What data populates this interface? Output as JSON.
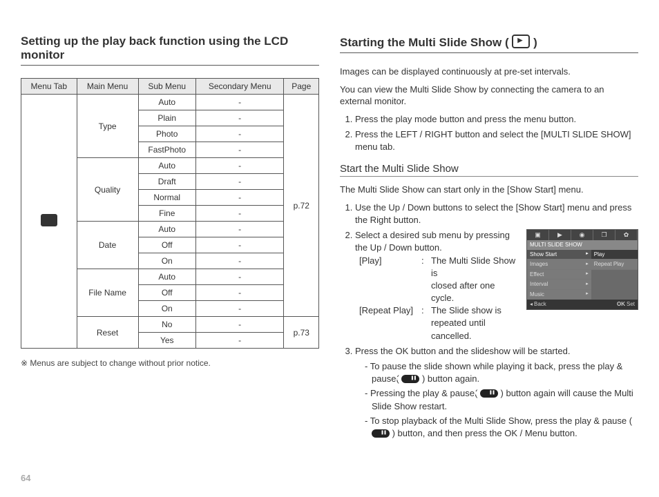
{
  "page_number": "64",
  "left": {
    "title": "Setting up the play back function using the LCD monitor",
    "table": {
      "headers": [
        "Menu Tab",
        "Main Menu",
        "Sub Menu",
        "Secondary Menu",
        "Page"
      ],
      "groups": [
        {
          "main": "Type",
          "subs": [
            "Auto",
            "Plain",
            "Photo",
            "FastPhoto"
          ],
          "page": "p.72"
        },
        {
          "main": "Quality",
          "subs": [
            "Auto",
            "Draft",
            "Normal",
            "Fine"
          ],
          "page": "p.72"
        },
        {
          "main": "Date",
          "subs": [
            "Auto",
            "Off",
            "On"
          ],
          "page": "p.72"
        },
        {
          "main": "File Name",
          "subs": [
            "Auto",
            "Off",
            "On"
          ],
          "page": "p.72"
        },
        {
          "main": "Reset",
          "subs": [
            "No",
            "Yes"
          ],
          "page": "p.73"
        }
      ],
      "secondary_dash": "-",
      "page_span1": "p.72",
      "page_span2": "p.73"
    },
    "footnote": "※  Menus are subject to change without prior notice."
  },
  "right": {
    "title_prefix": "Starting the Multi Slide Show ( ",
    "title_suffix": " )",
    "intro1": "Images can be displayed continuously at pre-set intervals.",
    "intro2": "You can view the Multi Slide Show by connecting the camera to an external monitor.",
    "steps_top": [
      "Press the play mode button and press the menu button.",
      "Press the LEFT / RIGHT button and select the [MULTI SLIDE SHOW] menu tab."
    ],
    "sub_title": "Start the Multi Slide Show",
    "sub_intro": "The Multi Slide Show can start only in the [Show Start] menu.",
    "sub_steps": {
      "s1": "Use the Up / Down buttons to select the [Show Start] menu and press the Right button.",
      "s2": "Select a desired sub menu by pressing the Up / Down button.",
      "defs": [
        {
          "label": "[Play]",
          "desc1": "The Multi Slide Show is",
          "desc2": "closed after one cycle."
        },
        {
          "label": "[Repeat Play]",
          "desc1": "The Slide show is",
          "desc2": "repeated until cancelled."
        }
      ],
      "s3": "Press the OK button and the slideshow will be started.",
      "bullets": [
        {
          "pre": "- To pause the slide shown while playing it back, press the play & pause( ",
          "post": " ) button again."
        },
        {
          "pre": "- Pressing the play & pause( ",
          "post": " ) button again will cause the Multi Slide Show restart."
        },
        {
          "pre": "- To stop playback of the Multi Slide Show, press the play & pause ( ",
          "post": " ) button, and then press the OK / Menu button."
        }
      ]
    },
    "lcd": {
      "title": "MULTI SLIDE SHOW",
      "left_items": [
        "Show Start",
        "Images",
        "Effect",
        "Interval",
        "Music"
      ],
      "right_items": [
        "Play",
        "Repeat Play"
      ],
      "back": "Back",
      "ok": "OK",
      "set": "Set"
    }
  }
}
